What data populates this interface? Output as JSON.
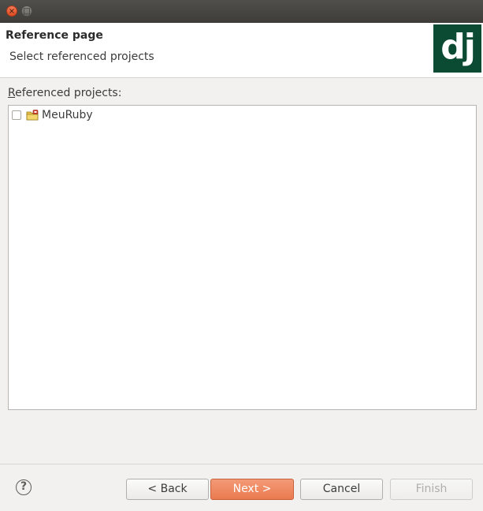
{
  "window": {
    "close_glyph": "×",
    "maximize_glyph": "□"
  },
  "header": {
    "title": "Reference page",
    "description": "Select referenced projects",
    "logo_text": "dj",
    "logo_color": "#0c4b33"
  },
  "referenced_projects": {
    "label_mnemonic": "R",
    "label_rest": "eferenced projects:",
    "items": [
      {
        "label": "MeuRuby",
        "checked": false,
        "icon": "project-folder-icon"
      }
    ]
  },
  "footer": {
    "help_glyph": "?",
    "back_label": "< Back",
    "next_label": "Next >",
    "cancel_label": "Cancel",
    "finish_label": "Finish",
    "accent_color": "#ea7a50"
  }
}
